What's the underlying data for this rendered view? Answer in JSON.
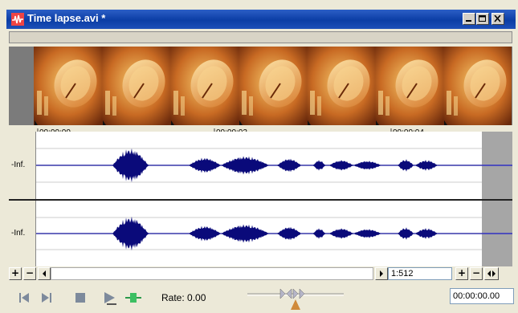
{
  "window": {
    "title": "Time lapse.avi *",
    "minimize_icon": "minimize-icon",
    "maximize_icon": "maximize-icon",
    "close_icon": "close-icon"
  },
  "timeline": {
    "marks": [
      "00:00:00",
      "00:00:02",
      "00:00:04"
    ]
  },
  "tracks": [
    {
      "level_label": "-Inf."
    },
    {
      "level_label": "-Inf."
    }
  ],
  "scrollbar": {
    "zoom_value": "1:512"
  },
  "transport": {
    "rate_label": "Rate: 0.00",
    "time_display": "00:00:00.00"
  },
  "colors": {
    "title_bar": "#0b3da5",
    "waveform": "#0a0a7a",
    "waveform_center": "#1a1ac8"
  }
}
